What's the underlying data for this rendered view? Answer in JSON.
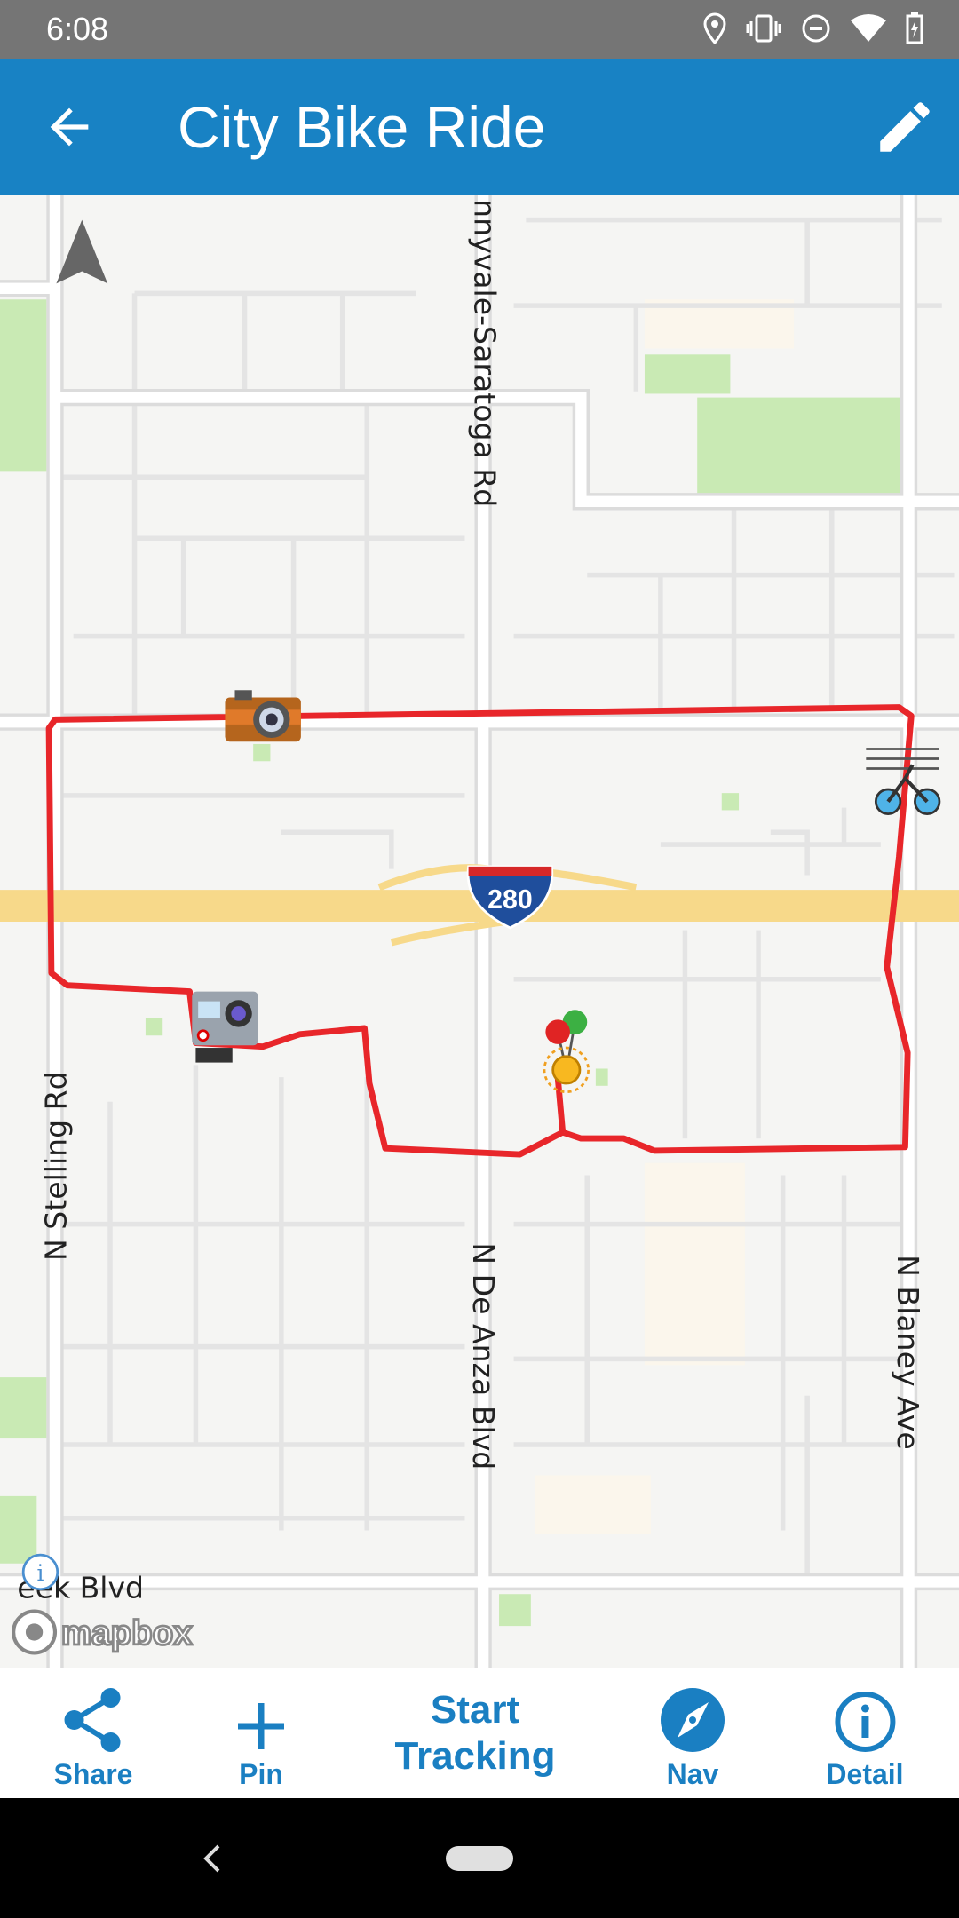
{
  "status_bar": {
    "time": "6:08",
    "icons": [
      "location-icon",
      "vibrate-icon",
      "do-not-disturb-icon",
      "wifi-icon",
      "battery-charging-icon"
    ]
  },
  "header": {
    "title": "City Bike Ride",
    "back_icon": "arrow-left-icon",
    "edit_icon": "pencil-icon",
    "color": "#1882c4"
  },
  "map": {
    "road_labels": {
      "saratoga": "nnyvale-Saratoga Rd",
      "stelling": "N Stelling Rd",
      "deanza": "N De Anza Blvd",
      "blaney": "N Blaney Ave",
      "creek": "eek Blvd"
    },
    "highway_shield": "280",
    "attribution": "mapbox",
    "route_color": "#e8262a",
    "markers": [
      "camera-icon",
      "action-camera-icon",
      "bicycle-icon",
      "balloons-icon"
    ]
  },
  "bottom_bar": {
    "share": "Share",
    "pin": "Pin",
    "start_tracking_line1": "Start",
    "start_tracking_line2": "Tracking",
    "nav": "Nav",
    "detail": "Detail",
    "color": "#1a7fc2"
  }
}
